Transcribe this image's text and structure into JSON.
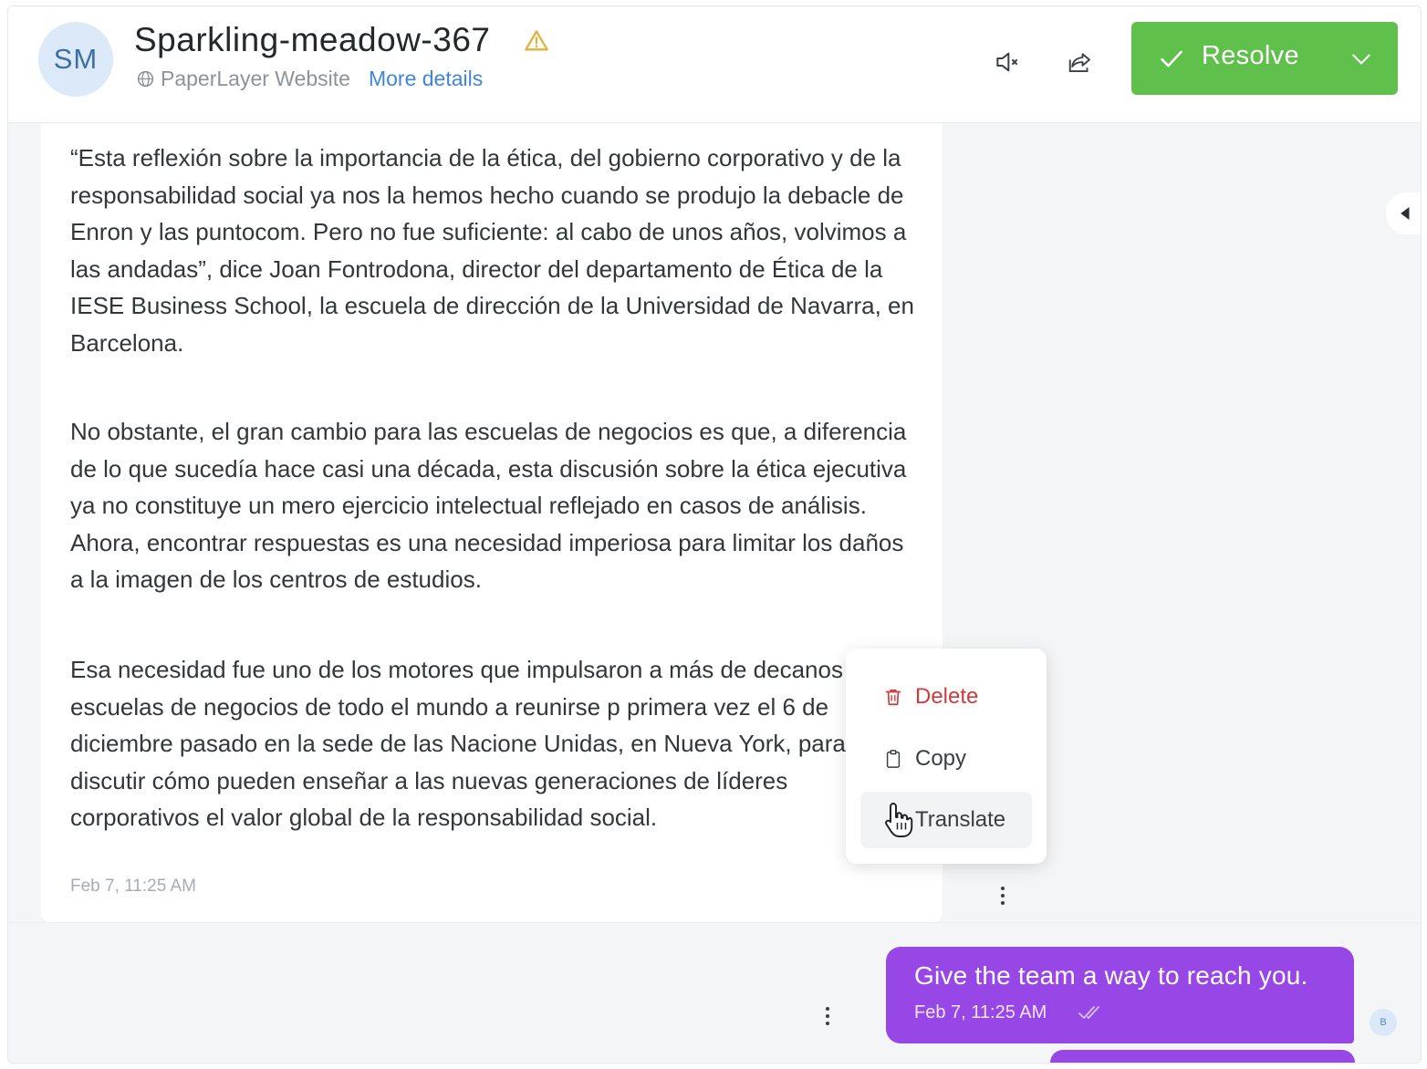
{
  "header": {
    "avatar_initials": "SM",
    "title": "Sparkling-meadow-367",
    "warning_icon": "warning-icon",
    "source": "PaperLayer Website",
    "more_details": "More details",
    "resolve_label": "Resolve"
  },
  "message": {
    "paragraphs": [
      "“Esta reflexión sobre la importancia de la ética, del gobierno corporativo y de la responsabilidad social ya nos la hemos hecho cuando se produjo la debacle de Enron y las puntocom. Pero no fue suficiente: al cabo de unos años, volvimos a las andadas”, dice Joan Fontrodona, director del departamento de Ética de la IESE Business School, la escuela de dirección de la Universidad de Navarra, en Barcelona.",
      "No obstante, el gran cambio para las escuelas de negocios es que, a diferencia de lo que sucedía hace casi una década, esta discusión sobre la ética ejecutiva ya no constituye un mero ejercicio intelectual reflejado en casos de análisis. Ahora, encontrar respuestas es una necesidad imperiosa para limitar los daños a la imagen de los centros de estudios.",
      "Esa necesidad fue uno de los motores que impulsaron a más de decanos de escuelas de negocios de todo el mundo a reunirse p primera vez el 6 de diciembre pasado en la sede de las Nacione Unidas, en Nueva York, para discutir cómo pueden enseñar a las nuevas generaciones de líderes corporativos el valor global de la responsabilidad social."
    ],
    "time": "Feb 7, 11:25 AM"
  },
  "context_menu": {
    "delete": "Delete",
    "copy": "Copy",
    "translate": "Translate"
  },
  "outgoing": {
    "text": "Give the team a way to reach you.",
    "time": "Feb 7, 11:25 AM",
    "avatar": "B"
  },
  "colors": {
    "resolve_green": "#5fc04b",
    "outgoing_purple": "#9747e6",
    "link_blue": "#3f86d8",
    "delete_red": "#cf3b3b"
  }
}
